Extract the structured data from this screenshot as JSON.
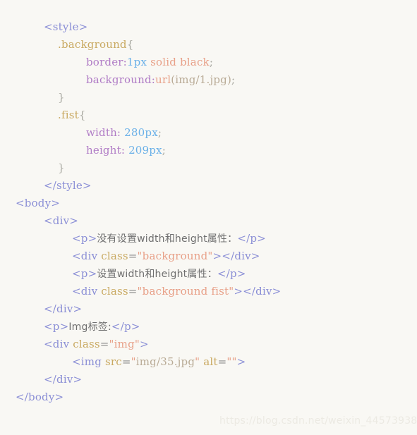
{
  "editor": {
    "background_color": "#f9f8f4",
    "language": "html",
    "line_count": 21
  },
  "palette": {
    "tag": "#8b8fd6",
    "selector": "#c9a961",
    "property": "#b07cc6",
    "number": "#6ab0e8",
    "string": "#e8a088",
    "path": "#b9ab96",
    "punctuation": "#a8a8a0",
    "text": "#6f6f6f"
  },
  "code": {
    "lines": [
      {
        "indent": 2,
        "tokens": [
          {
            "t": "<style>",
            "c": "tag"
          }
        ]
      },
      {
        "indent": 3,
        "tokens": [
          {
            "t": ".background",
            "c": "sel"
          },
          {
            "t": "{",
            "c": "punct"
          }
        ]
      },
      {
        "indent": 5,
        "tokens": [
          {
            "t": "border:",
            "c": "prop"
          },
          {
            "t": "1px",
            "c": "num"
          },
          {
            "t": " ",
            "c": "plain"
          },
          {
            "t": "solid black",
            "c": "str"
          },
          {
            "t": ";",
            "c": "punct"
          }
        ]
      },
      {
        "indent": 5,
        "tokens": [
          {
            "t": "background:",
            "c": "prop"
          },
          {
            "t": "url",
            "c": "str"
          },
          {
            "t": "(img/1.jpg)",
            "c": "path"
          },
          {
            "t": ";",
            "c": "punct"
          }
        ]
      },
      {
        "indent": 3,
        "tokens": [
          {
            "t": "}",
            "c": "punct"
          }
        ]
      },
      {
        "indent": 3,
        "tokens": [
          {
            "t": ".fist",
            "c": "sel"
          },
          {
            "t": "{",
            "c": "punct"
          }
        ]
      },
      {
        "indent": 5,
        "tokens": [
          {
            "t": "width: ",
            "c": "prop"
          },
          {
            "t": "280px",
            "c": "num"
          },
          {
            "t": ";",
            "c": "punct"
          }
        ]
      },
      {
        "indent": 5,
        "tokens": [
          {
            "t": "height: ",
            "c": "prop"
          },
          {
            "t": "209px",
            "c": "num"
          },
          {
            "t": ";",
            "c": "punct"
          }
        ]
      },
      {
        "indent": 3,
        "tokens": [
          {
            "t": "}",
            "c": "punct"
          }
        ]
      },
      {
        "indent": 2,
        "tokens": [
          {
            "t": "</style>",
            "c": "tag"
          }
        ]
      },
      {
        "indent": 0,
        "tokens": [
          {
            "t": "<body>",
            "c": "tag"
          }
        ]
      },
      {
        "indent": 2,
        "tokens": [
          {
            "t": "<div>",
            "c": "tag"
          }
        ]
      },
      {
        "indent": 4,
        "tokens": [
          {
            "t": "<p>",
            "c": "tag"
          },
          {
            "t": "没有设置width和height属性：",
            "c": "text"
          },
          {
            "t": "</p>",
            "c": "tag"
          }
        ]
      },
      {
        "indent": 4,
        "tokens": [
          {
            "t": "<div ",
            "c": "tag"
          },
          {
            "t": "class",
            "c": "sel"
          },
          {
            "t": "=",
            "c": "plain"
          },
          {
            "t": "\"background\"",
            "c": "str"
          },
          {
            "t": ">",
            "c": "tag"
          },
          {
            "t": "</div>",
            "c": "tag"
          }
        ]
      },
      {
        "indent": 4,
        "tokens": [
          {
            "t": "<p>",
            "c": "tag"
          },
          {
            "t": "设置width和height属性：",
            "c": "text"
          },
          {
            "t": "</p>",
            "c": "tag"
          }
        ]
      },
      {
        "indent": 4,
        "tokens": [
          {
            "t": "<div ",
            "c": "tag"
          },
          {
            "t": "class",
            "c": "sel"
          },
          {
            "t": "=",
            "c": "plain"
          },
          {
            "t": "\"background fist\"",
            "c": "str"
          },
          {
            "t": ">",
            "c": "tag"
          },
          {
            "t": "</div>",
            "c": "tag"
          }
        ]
      },
      {
        "indent": 2,
        "tokens": [
          {
            "t": "</div>",
            "c": "tag"
          }
        ]
      },
      {
        "indent": 2,
        "tokens": [
          {
            "t": "<p>",
            "c": "tag"
          },
          {
            "t": "Img标签:",
            "c": "text"
          },
          {
            "t": "</p>",
            "c": "tag"
          }
        ]
      },
      {
        "indent": 2,
        "tokens": [
          {
            "t": "<div ",
            "c": "tag"
          },
          {
            "t": "class",
            "c": "sel"
          },
          {
            "t": "=",
            "c": "plain"
          },
          {
            "t": "\"img\"",
            "c": "str"
          },
          {
            "t": ">",
            "c": "tag"
          }
        ]
      },
      {
        "indent": 4,
        "tokens": [
          {
            "t": "<img ",
            "c": "tag"
          },
          {
            "t": "src",
            "c": "sel"
          },
          {
            "t": "=",
            "c": "plain"
          },
          {
            "t": "\"",
            "c": "str"
          },
          {
            "t": "img/35.jpg",
            "c": "path"
          },
          {
            "t": "\"",
            "c": "str"
          },
          {
            "t": " ",
            "c": "plain"
          },
          {
            "t": "alt",
            "c": "sel"
          },
          {
            "t": "=",
            "c": "plain"
          },
          {
            "t": "\"\"",
            "c": "str"
          },
          {
            "t": ">",
            "c": "tag"
          }
        ]
      },
      {
        "indent": 2,
        "tokens": [
          {
            "t": "</div>",
            "c": "tag"
          }
        ]
      },
      {
        "indent": 0,
        "tokens": [
          {
            "t": "</body>",
            "c": "tag"
          }
        ]
      }
    ]
  },
  "watermark": {
    "text": "https://blog.csdn.net/weixin_44573938"
  }
}
